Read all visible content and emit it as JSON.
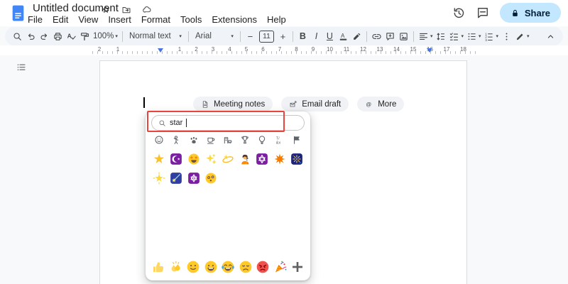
{
  "header": {
    "title": "Untitled document",
    "menus": [
      "File",
      "Edit",
      "View",
      "Insert",
      "Format",
      "Tools",
      "Extensions",
      "Help"
    ],
    "share_label": "Share"
  },
  "toolbar": {
    "zoom": "100%",
    "paragraph_style": "Normal text",
    "font": "Arial",
    "font_size": "11"
  },
  "ruler": {
    "margin_labels": [
      "2",
      "1"
    ],
    "labels": [
      "1",
      "2",
      "3",
      "4",
      "5",
      "6",
      "7",
      "8",
      "9",
      "10",
      "11",
      "12",
      "13",
      "14",
      "15",
      "16",
      "17",
      "18"
    ]
  },
  "document": {
    "chips": [
      {
        "label": "Meeting notes",
        "icon": "doc-chip-icon"
      },
      {
        "label": "Email draft",
        "icon": "email-chip-icon"
      },
      {
        "label": "More",
        "icon": "at-icon"
      }
    ]
  },
  "emoji_picker": {
    "search_value": "star",
    "categories": [
      {
        "name": "smileys-and-emotions",
        "style": "cat-smile"
      },
      {
        "name": "people",
        "style": "cat-people"
      },
      {
        "name": "animals-and-nature",
        "style": "cat-animal"
      },
      {
        "name": "food-and-drink",
        "style": "cat-food"
      },
      {
        "name": "travel-and-places",
        "style": "cat-travel"
      },
      {
        "name": "activities-and-events",
        "style": "cat-activity"
      },
      {
        "name": "objects",
        "style": "cat-object"
      },
      {
        "name": "symbols",
        "style": "cat-symbol"
      },
      {
        "name": "flags",
        "style": "cat-flag"
      }
    ],
    "results_rows": [
      [
        {
          "glyph": "⭐",
          "name": "star",
          "style": "star"
        },
        {
          "glyph": "☪️",
          "name": "star-and-crescent",
          "style": "crescent"
        },
        {
          "glyph": "🤩",
          "name": "star-struck",
          "style": "starstruck"
        },
        {
          "glyph": "✨",
          "name": "sparkles",
          "style": "sparkles"
        },
        {
          "glyph": "💫",
          "name": "dizzy",
          "style": "dizzy"
        },
        {
          "glyph": "🧑‍🎤",
          "name": "singer",
          "style": "singer"
        },
        {
          "glyph": "✡️",
          "name": "star-of-david",
          "style": "david"
        },
        {
          "glyph": "✴️",
          "name": "eight-pointed-star",
          "style": "eightstar"
        },
        {
          "glyph": "🎆",
          "name": "fireworks",
          "style": "fireworks"
        }
      ],
      [
        {
          "glyph": "🌟",
          "name": "glowing-star",
          "style": "glowstar"
        },
        {
          "glyph": "🌠",
          "name": "shooting-star",
          "style": "shootstar"
        },
        {
          "glyph": "🔯",
          "name": "dotted-six-pointed-star",
          "style": "sixstar"
        },
        {
          "glyph": "😵‍💫",
          "name": "face-with-spiral-eyes",
          "style": "spiral"
        }
      ]
    ],
    "recent": [
      {
        "glyph": "👍",
        "name": "thumbs-up",
        "style": "thumbs"
      },
      {
        "glyph": "👏",
        "name": "clapping-hands",
        "style": "clap"
      },
      {
        "glyph": "🙂",
        "name": "slightly-smiling-face",
        "style": "smile"
      },
      {
        "glyph": "😀",
        "name": "grinning-face",
        "style": "grin"
      },
      {
        "glyph": "😂",
        "name": "face-with-tears-of-joy",
        "style": "joy"
      },
      {
        "glyph": "😞",
        "name": "disappointed-face",
        "style": "sad"
      },
      {
        "glyph": "😡",
        "name": "angry-face",
        "style": "angry"
      },
      {
        "glyph": "🎉",
        "name": "party-popper",
        "style": "party"
      }
    ]
  },
  "colors": {
    "share_bg": "#c2e7ff",
    "annotation_red": "#e8453c",
    "docs_blue": "#4285f4",
    "purple_tile": "#7b1fa2",
    "dark_tile": "#1a237e",
    "toolbar_bg": "#f0f4f9",
    "canvas_bg": "#f8f9fa"
  }
}
